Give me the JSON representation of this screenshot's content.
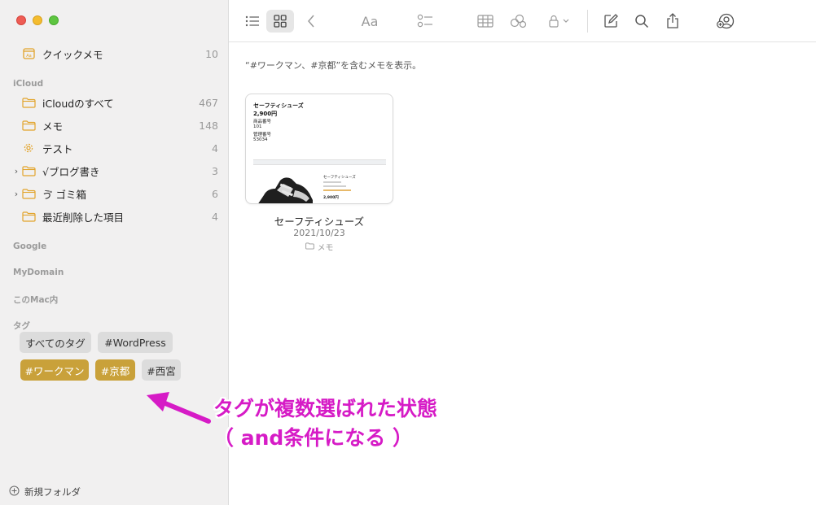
{
  "sidebar": {
    "quick_note": {
      "label": "クイックメモ",
      "count": "10"
    },
    "sections": {
      "icloud": "iCloud",
      "google": "Google",
      "mydomain": "MyDomain",
      "mac": "このMac内",
      "tags": "タグ"
    },
    "items": [
      {
        "label": "iCloudのすべて",
        "count": "467",
        "icon": "folder-icon"
      },
      {
        "label": "メモ",
        "count": "148",
        "icon": "folder-icon"
      },
      {
        "label": "テスト",
        "count": "4",
        "icon": "gear-icon"
      },
      {
        "label": "√ブログ書き",
        "count": "3",
        "icon": "folder-icon"
      },
      {
        "label": "ゴミ箱",
        "prefix": "ゔ",
        "count": "6",
        "icon": "folder-icon"
      },
      {
        "label": "最近削除した項目",
        "count": "4",
        "icon": "folder-icon"
      }
    ],
    "tags": [
      {
        "label": "すべてのタグ",
        "selected": false
      },
      {
        "label": "#WordPress",
        "selected": false
      },
      {
        "label": "#ワークマン",
        "selected": true
      },
      {
        "label": "#京都",
        "selected": true
      },
      {
        "label": "#西宮",
        "selected": false
      }
    ],
    "new_folder": "新規フォルダ"
  },
  "toolbar": {
    "icons": [
      "list-view-icon",
      "gallery-view-icon",
      "back-icon",
      "format-icon",
      "checklist-icon",
      "table-icon",
      "attachment-icon",
      "lock-icon",
      "compose-icon",
      "search-icon",
      "share-icon",
      "collaborate-icon"
    ],
    "format_label": "Aa"
  },
  "main": {
    "search_desc": "“#ワークマン、#京都”を含むメモを表示。",
    "note": {
      "title": "セーフティシューズ",
      "date": "2021/10/23",
      "folder": "メモ",
      "preview": {
        "line1": "セーフティシューズ",
        "line2": "2,900円",
        "line3": "商品番号",
        "line4": "101",
        "line5": "管理番号",
        "line6": "53034",
        "product": "セーフティシューズ",
        "price": "2,900円"
      }
    }
  },
  "annotation": {
    "line1": "タグが複数選ばれた状態",
    "line2": "（ and条件になる ）",
    "color": "#d61bc6"
  },
  "colors": {
    "selected_tag": "#c9a13a",
    "folder_icon": "#e2a42b",
    "sidebar_bg": "#f1f0f0"
  }
}
